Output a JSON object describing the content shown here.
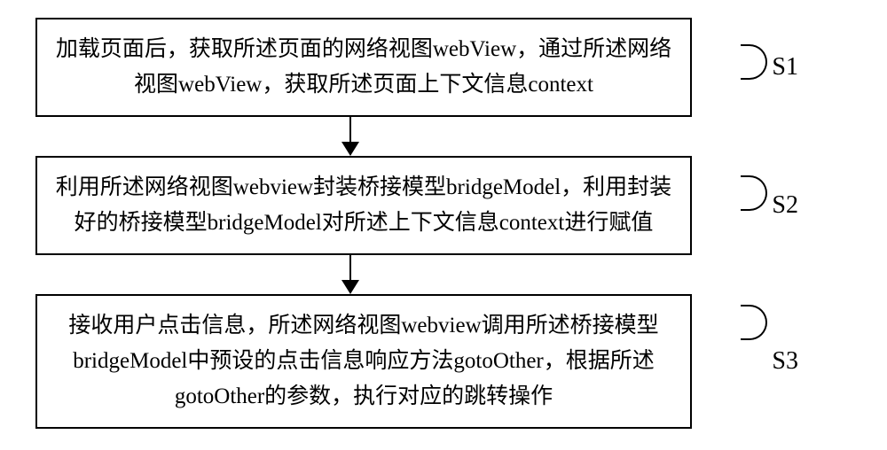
{
  "steps": [
    {
      "label": "S1",
      "text": "加载页面后，获取所述页面的网络视图webView，通过所述网络视图webView，获取所述页面上下文信息context"
    },
    {
      "label": "S2",
      "text": "利用所述网络视图webview封装桥接模型bridgeModel，利用封装好的桥接模型bridgeModel对所述上下文信息context进行赋值"
    },
    {
      "label": "S3",
      "text": "接收用户点击信息，所述网络视图webview调用所述桥接模型bridgeModel中预设的点击信息响应方法gotoOther，根据所述gotoOther的参数，执行对应的跳转操作"
    }
  ]
}
